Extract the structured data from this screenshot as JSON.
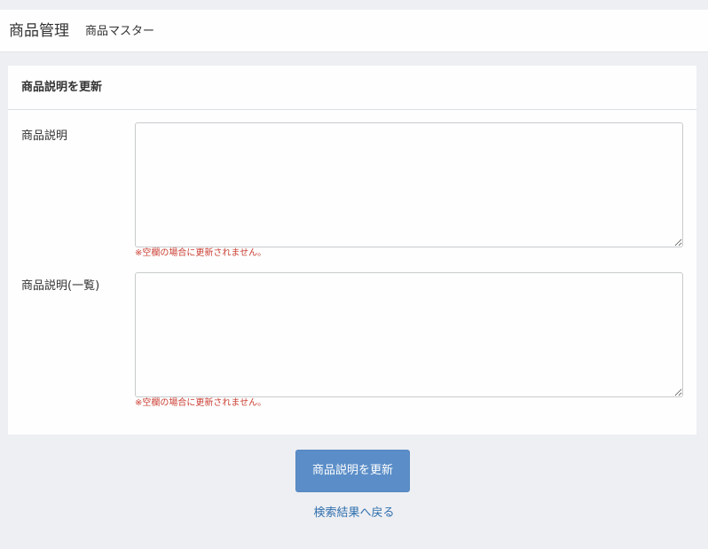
{
  "header": {
    "title": "商品管理",
    "subtitle": "商品マスター"
  },
  "panel": {
    "title": "商品説明を更新",
    "fields": [
      {
        "label": "商品説明",
        "value": "",
        "note": "※空欄の場合に更新されません。"
      },
      {
        "label": "商品説明(一覧)",
        "value": "",
        "note": "※空欄の場合に更新されません。"
      }
    ]
  },
  "actions": {
    "submit_label": "商品説明を更新",
    "back_label": "検索結果へ戻る"
  },
  "colors": {
    "page_background": "#eeeff3",
    "panel_background": "#fdfefd",
    "primary_button": "#5b8ec8",
    "note_red": "#cc3e34",
    "link_blue": "#2f6fad"
  }
}
